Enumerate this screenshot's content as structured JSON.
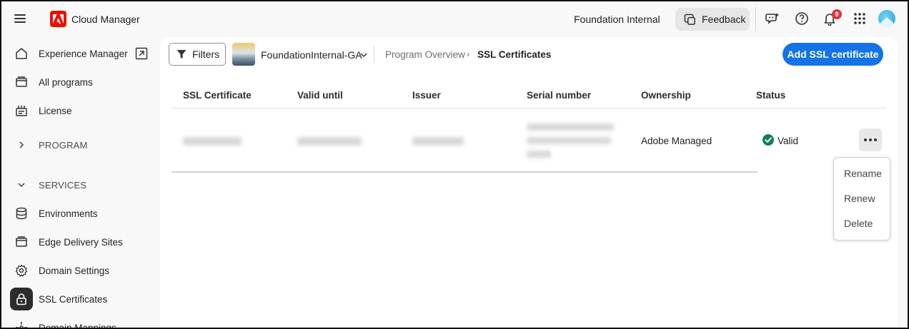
{
  "header": {
    "app_title": "Cloud Manager",
    "org_name": "Foundation Internal",
    "feedback_label": "Feedback",
    "notification_count": "9",
    "icons": [
      "menu-icon",
      "adobe-logo",
      "feedback-icon",
      "chat-icon",
      "help-icon",
      "bell-icon",
      "apps-grid-icon",
      "avatar"
    ]
  },
  "sidebar": {
    "items": [
      {
        "label": "Experience Manager",
        "icon": "home-icon"
      },
      {
        "label": "All programs",
        "icon": "programs-icon"
      },
      {
        "label": "License",
        "icon": "license-icon"
      },
      {
        "label": "PROGRAM",
        "icon": "chevron-right-icon"
      },
      {
        "label": "SERVICES",
        "icon": "chevron-down-icon"
      },
      {
        "label": "Environments",
        "icon": "database-icon"
      },
      {
        "label": "Edge Delivery Sites",
        "icon": "sites-icon"
      },
      {
        "label": "Domain Settings",
        "icon": "gear-icon"
      },
      {
        "label": "SSL Certificates",
        "icon": "lock-icon"
      },
      {
        "label": "Domain Mappings",
        "icon": "mapping-icon"
      }
    ]
  },
  "toolbar": {
    "filters_label": "Filters",
    "program_name": "FoundationInternal-GA",
    "breadcrumb": [
      "Program Overview",
      "SSL Certificates"
    ],
    "add_label": "Add SSL certificate"
  },
  "table": {
    "columns": [
      "SSL Certificate",
      "Valid until",
      "Issuer",
      "Serial number",
      "Ownership",
      "Status"
    ],
    "rows": [
      {
        "ownership": "Adobe Managed",
        "status": "Valid"
      }
    ]
  },
  "context_menu": {
    "items": [
      "Rename",
      "Renew",
      "Delete"
    ]
  },
  "colors": {
    "accent": "#1473e6",
    "brand": "#eb1000",
    "valid": "#12805c",
    "badge": "#d7373f"
  }
}
